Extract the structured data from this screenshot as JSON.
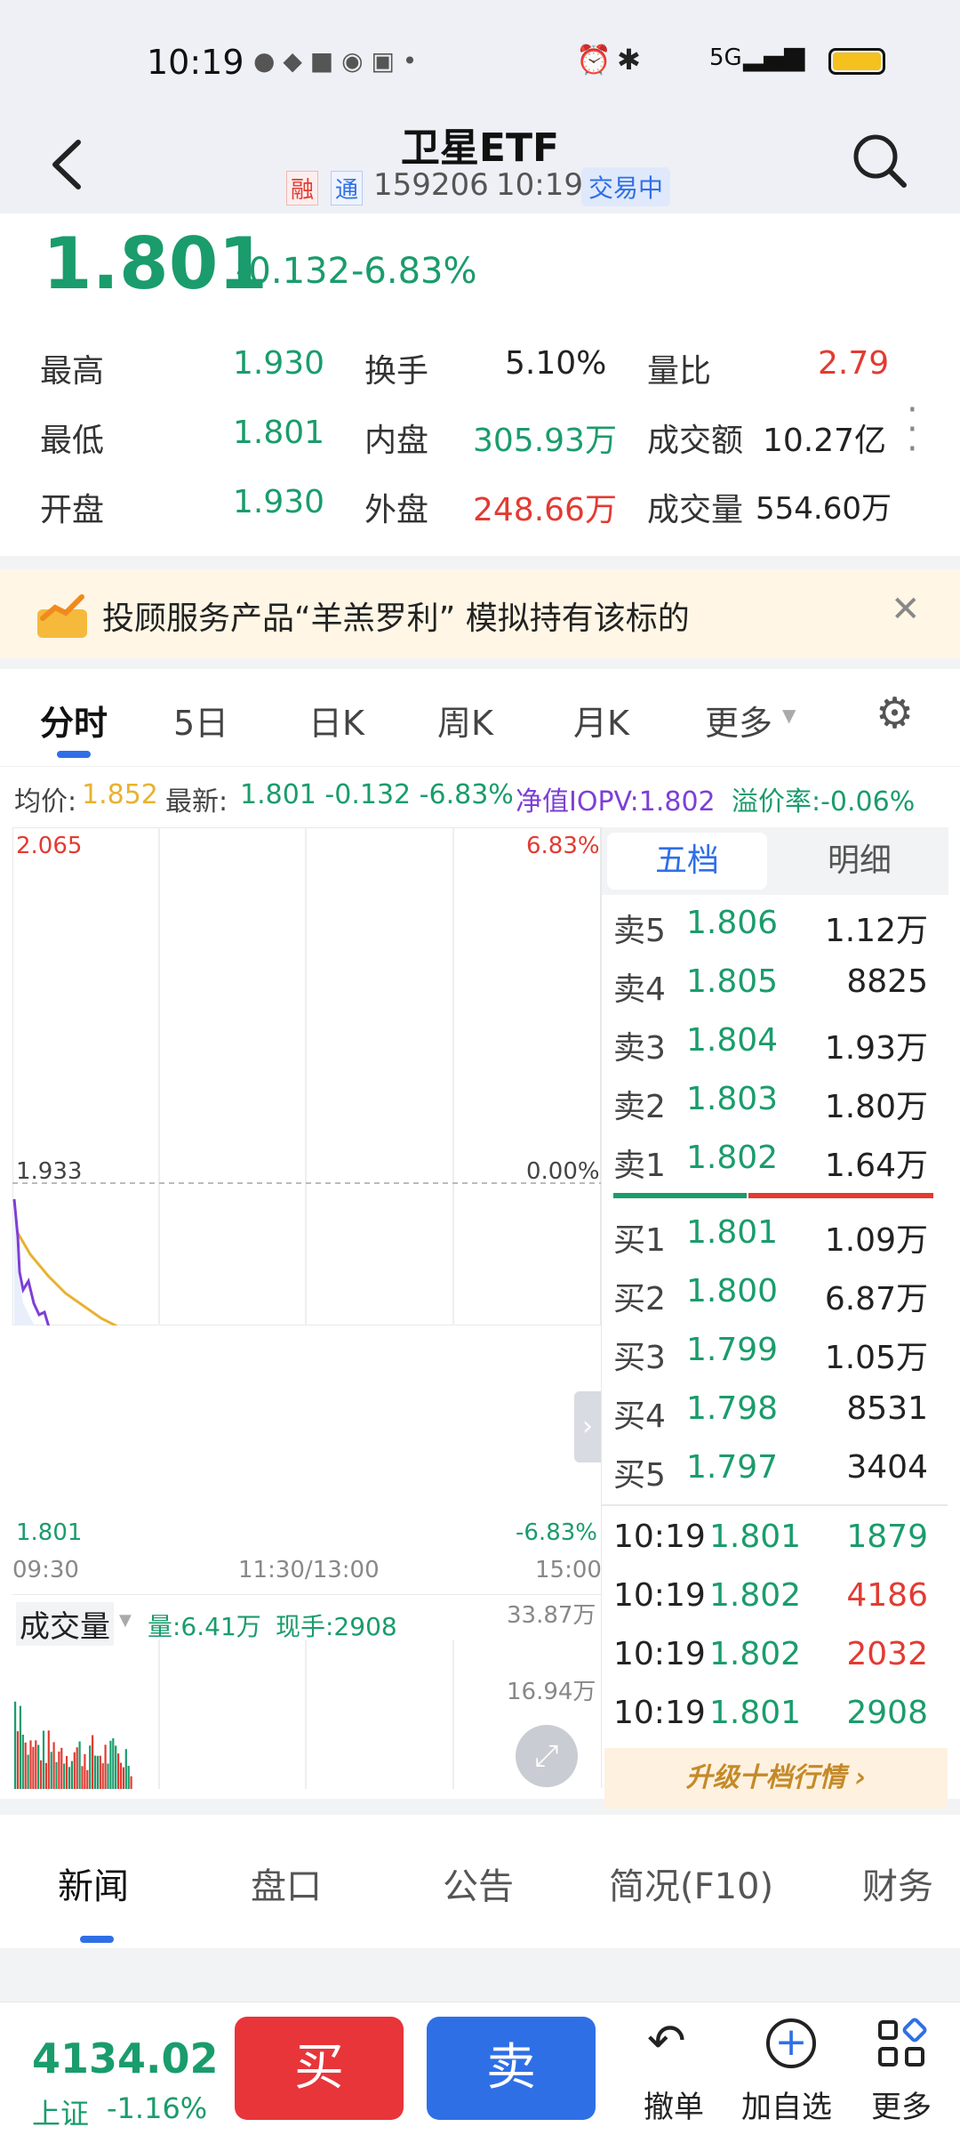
{
  "status_bar": {
    "time": "10:19",
    "network": "5G"
  },
  "header": {
    "title": "卫星ETF",
    "badge1": "融",
    "badge2": "通",
    "code": "159206",
    "time": "10:19",
    "status": "交易中"
  },
  "price": {
    "last": "1.801",
    "change": "-0.132",
    "pct": "-6.83%"
  },
  "stats": {
    "high_label": "最高",
    "high": "1.930",
    "low_label": "最低",
    "low": "1.801",
    "open_label": "开盘",
    "open": "1.930",
    "turnover_label": "换手",
    "turnover": "5.10%",
    "inner_label": "内盘",
    "inner": "305.93万",
    "outer_label": "外盘",
    "outer": "248.66万",
    "volratio_label": "量比",
    "volratio": "2.79",
    "amount_label": "成交额",
    "amount": "10.27亿",
    "volume_label": "成交量",
    "volume": "554.60万"
  },
  "banner": {
    "text": "投顾服务产品“羊羔罗利” 模拟持有该标的"
  },
  "chart_tabs": [
    "分时",
    "5日",
    "日K",
    "周K",
    "月K",
    "更多"
  ],
  "info_line": {
    "avg_label": "均价:",
    "avg": "1.852",
    "latest_label": "最新:",
    "latest": "1.801 -0.132 -6.83%",
    "iopv": "净值IOPV:1.802",
    "premium": "溢价率:-0.06%"
  },
  "chart_labels": {
    "top_left": "2.065",
    "top_right": "6.83%",
    "mid_left": "1.933",
    "mid_right": "0.00%",
    "bot_left": "1.801",
    "bot_right": "-6.83%",
    "time_start": "09:30",
    "time_mid": "11:30/13:00",
    "time_end": "15:00"
  },
  "volume_panel": {
    "title": "成交量",
    "vol": "量:6.41万",
    "now": "现手:2908",
    "max": "33.87万",
    "half": "16.94万"
  },
  "orderbook": {
    "tab_active": "五档",
    "tab_other": "明细",
    "sells": [
      {
        "label": "卖5",
        "price": "1.806",
        "vol": "1.12万"
      },
      {
        "label": "卖4",
        "price": "1.805",
        "vol": "8825"
      },
      {
        "label": "卖3",
        "price": "1.804",
        "vol": "1.93万"
      },
      {
        "label": "卖2",
        "price": "1.803",
        "vol": "1.80万"
      },
      {
        "label": "卖1",
        "price": "1.802",
        "vol": "1.64万"
      }
    ],
    "buys": [
      {
        "label": "买1",
        "price": "1.801",
        "vol": "1.09万"
      },
      {
        "label": "买2",
        "price": "1.800",
        "vol": "6.87万"
      },
      {
        "label": "买3",
        "price": "1.799",
        "vol": "1.05万"
      },
      {
        "label": "买4",
        "price": "1.798",
        "vol": "8531"
      },
      {
        "label": "买5",
        "price": "1.797",
        "vol": "3404"
      }
    ],
    "ticks": [
      {
        "time": "10:19",
        "price": "1.801",
        "vol": "1879",
        "color": "#1a9c6c"
      },
      {
        "time": "10:19",
        "price": "1.802",
        "vol": "4186",
        "color": "#e23b32"
      },
      {
        "time": "10:19",
        "price": "1.802",
        "vol": "2032",
        "color": "#e23b32"
      },
      {
        "time": "10:19",
        "price": "1.801",
        "vol": "2908",
        "color": "#1a9c6c"
      }
    ],
    "upgrade": "升级十档行情"
  },
  "bottom_tabs": [
    "新闻",
    "盘口",
    "公告",
    "简况(F10)",
    "财务"
  ],
  "bottom_bar": {
    "index_value": "4134.02",
    "index_name": "上证",
    "index_change": "-1.16%",
    "buy": "买",
    "sell": "卖",
    "cancel": "撤单",
    "watch": "加自选",
    "more": "更多"
  },
  "colors": {
    "up": "#e23b32",
    "down": "#1a9c6c",
    "accent": "#2f6fe6",
    "avg_line": "#e8b230",
    "price_line": "#7d3fd6"
  }
}
